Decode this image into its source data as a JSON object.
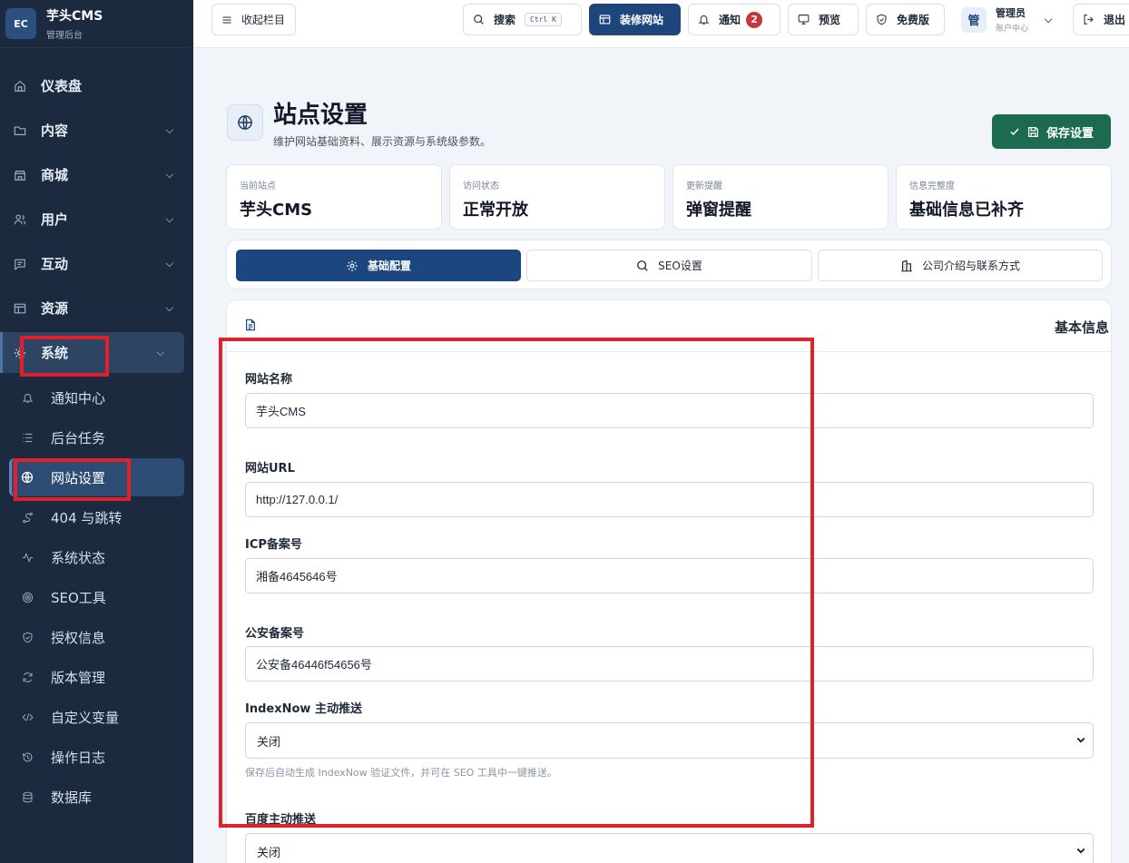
{
  "brand": {
    "logo": "EC",
    "title": "芋头CMS",
    "subtitle": "管理后台"
  },
  "sidebar": {
    "items": [
      {
        "label": "仪表盘",
        "icon": "home-icon"
      },
      {
        "label": "内容",
        "icon": "folder-icon"
      },
      {
        "label": "商城",
        "icon": "store-icon"
      },
      {
        "label": "用户",
        "icon": "users-icon"
      },
      {
        "label": "互动",
        "icon": "message-icon"
      },
      {
        "label": "资源",
        "icon": "layout-icon"
      },
      {
        "label": "系统",
        "icon": "sun-icon"
      }
    ],
    "subitems": [
      {
        "label": "通知中心",
        "icon": "bell-icon"
      },
      {
        "label": "后台任务",
        "icon": "list-icon"
      },
      {
        "label": "网站设置",
        "icon": "globe-icon"
      },
      {
        "label": "404 与跳转",
        "icon": "route-icon"
      },
      {
        "label": "系统状态",
        "icon": "activity-icon"
      },
      {
        "label": "SEO工具",
        "icon": "target-icon"
      },
      {
        "label": "授权信息",
        "icon": "shield-icon"
      },
      {
        "label": "版本管理",
        "icon": "refresh-icon"
      },
      {
        "label": "自定义变量",
        "icon": "code-icon"
      },
      {
        "label": "操作日志",
        "icon": "history-icon"
      },
      {
        "label": "数据库",
        "icon": "database-icon"
      }
    ]
  },
  "topbar": {
    "collapse": "收起栏目",
    "search": "搜索",
    "search_kbd": "Ctrl K",
    "decorate": "装修网站",
    "notify": "通知",
    "notify_count": "2",
    "preview": "预览",
    "free": "免费版",
    "avatar": "管",
    "user_name": "管理员",
    "user_sub": "账户中心",
    "logout": "退出"
  },
  "page": {
    "title": "站点设置",
    "description": "维护网站基础资料、展示资源与系统级参数。",
    "save": "保存设置"
  },
  "stats": [
    {
      "label": "当前站点",
      "value": "芋头CMS"
    },
    {
      "label": "访问状态",
      "value": "正常开放"
    },
    {
      "label": "更新提醒",
      "value": "弹窗提醒"
    },
    {
      "label": "信息完整度",
      "value": "基础信息已补齐"
    }
  ],
  "tabs": [
    {
      "label": "基础配置",
      "icon": "gear-icon"
    },
    {
      "label": "SEO设置",
      "icon": "search-icon"
    },
    {
      "label": "公司介绍与联系方式",
      "icon": "building-icon"
    }
  ],
  "card": {
    "title": "基本信息"
  },
  "form": {
    "site_name": {
      "label": "网站名称",
      "value": "芋头CMS"
    },
    "site_url": {
      "label": "网站URL",
      "value": "http://127.0.0.1/"
    },
    "icp": {
      "label": "ICP备案号",
      "value": "湘备4645646号"
    },
    "police": {
      "label": "公安备案号",
      "value": "公安备46446f54656号"
    },
    "indexnow": {
      "label": "IndexNow 主动推送",
      "value": "关闭",
      "help": "保存后自动生成 IndexNow 验证文件，并可在 SEO 工具中一键推送。"
    },
    "baidu": {
      "label": "百度主动推送",
      "value": "关闭"
    }
  },
  "colors": {
    "sidebar_bg": "#1b2a3f",
    "primary": "#1e467c",
    "save": "#1d6b4f",
    "highlight": "#e0202a",
    "badge": "#c6373a"
  }
}
